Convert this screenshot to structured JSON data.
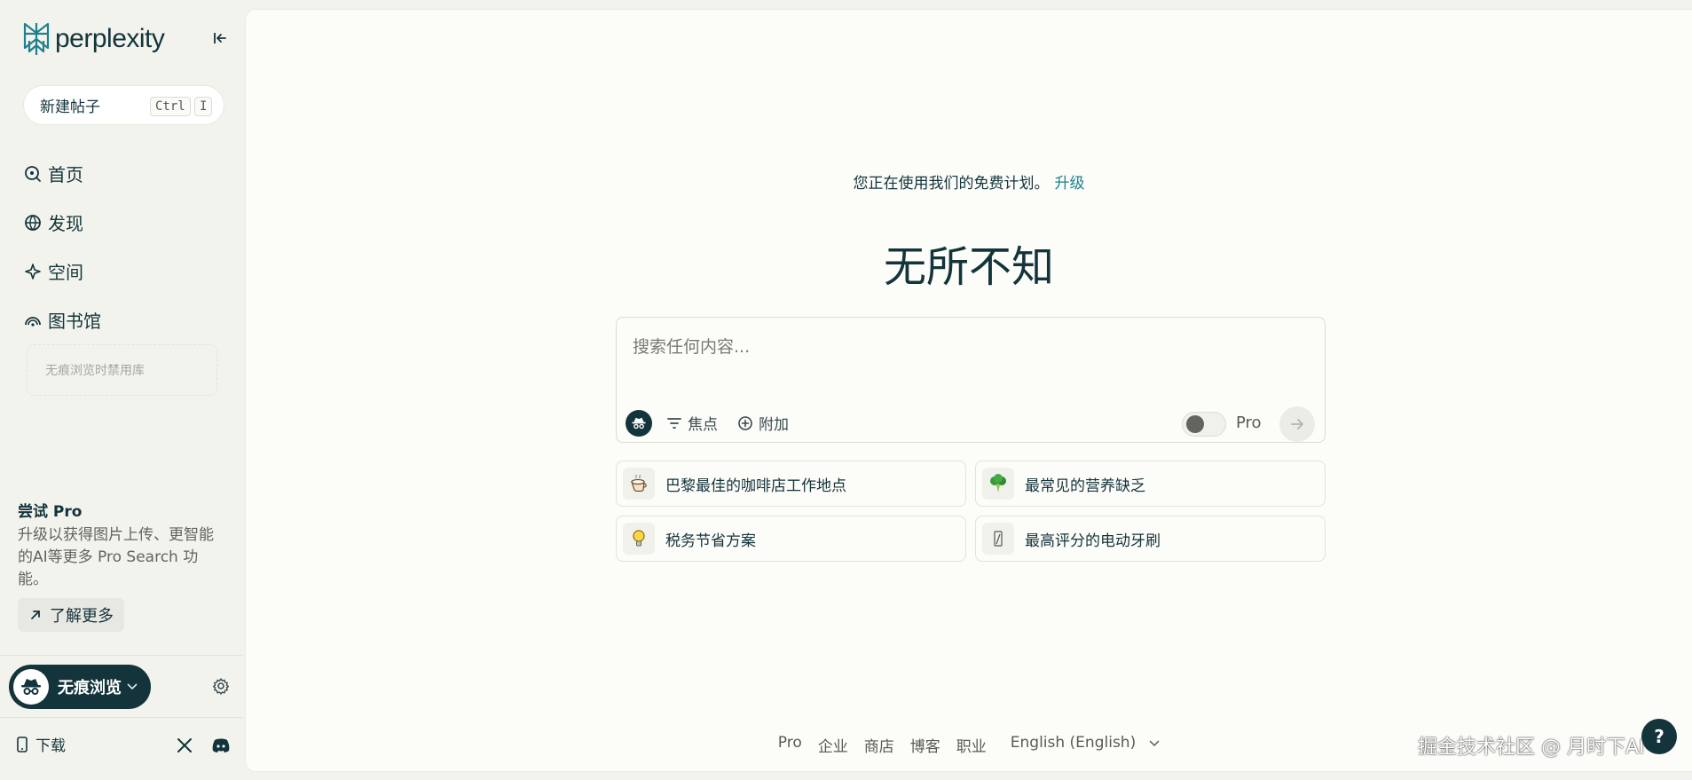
{
  "brand": {
    "name": "perplexity",
    "accent": "#20808d",
    "dark": "#13343b"
  },
  "sidebar": {
    "new_thread": {
      "label": "新建帖子",
      "kbd_ctrl": "Ctrl",
      "kbd_key": "I"
    },
    "items": [
      {
        "label": "首页",
        "icon": "home-search-icon"
      },
      {
        "label": "发现",
        "icon": "globe-icon"
      },
      {
        "label": "空间",
        "icon": "sparkle-icon"
      },
      {
        "label": "图书馆",
        "icon": "library-icon"
      }
    ],
    "library_empty": "无痕浏览时禁用库",
    "promo": {
      "title": "尝试 Pro",
      "desc": "升级以获得图片上传、更智能的AI等更多 Pro Search 功能。",
      "button": "了解更多"
    },
    "incognito": {
      "label": "无痕浏览"
    },
    "download": "下载"
  },
  "main": {
    "plan_note": "您正在使用我们的免费计划。",
    "upgrade": "升级",
    "hero": "无所不知",
    "search": {
      "placeholder": "搜索任何内容...",
      "focus": "焦点",
      "attach": "附加",
      "pro": "Pro"
    },
    "suggestions": [
      {
        "text": "巴黎最佳的咖啡店工作地点",
        "icon": "coffee-icon"
      },
      {
        "text": "最常见的营养缺乏",
        "icon": "broccoli-icon"
      },
      {
        "text": "税务节省方案",
        "icon": "lightbulb-icon"
      },
      {
        "text": "最高评分的电动牙刷",
        "icon": "toothbrush-icon"
      }
    ]
  },
  "footer": {
    "links": [
      "Pro",
      "企业",
      "商店",
      "博客",
      "职业"
    ],
    "language": "English (English)"
  },
  "watermark": "掘金技术社区 @ 月时下AI",
  "help": "?"
}
